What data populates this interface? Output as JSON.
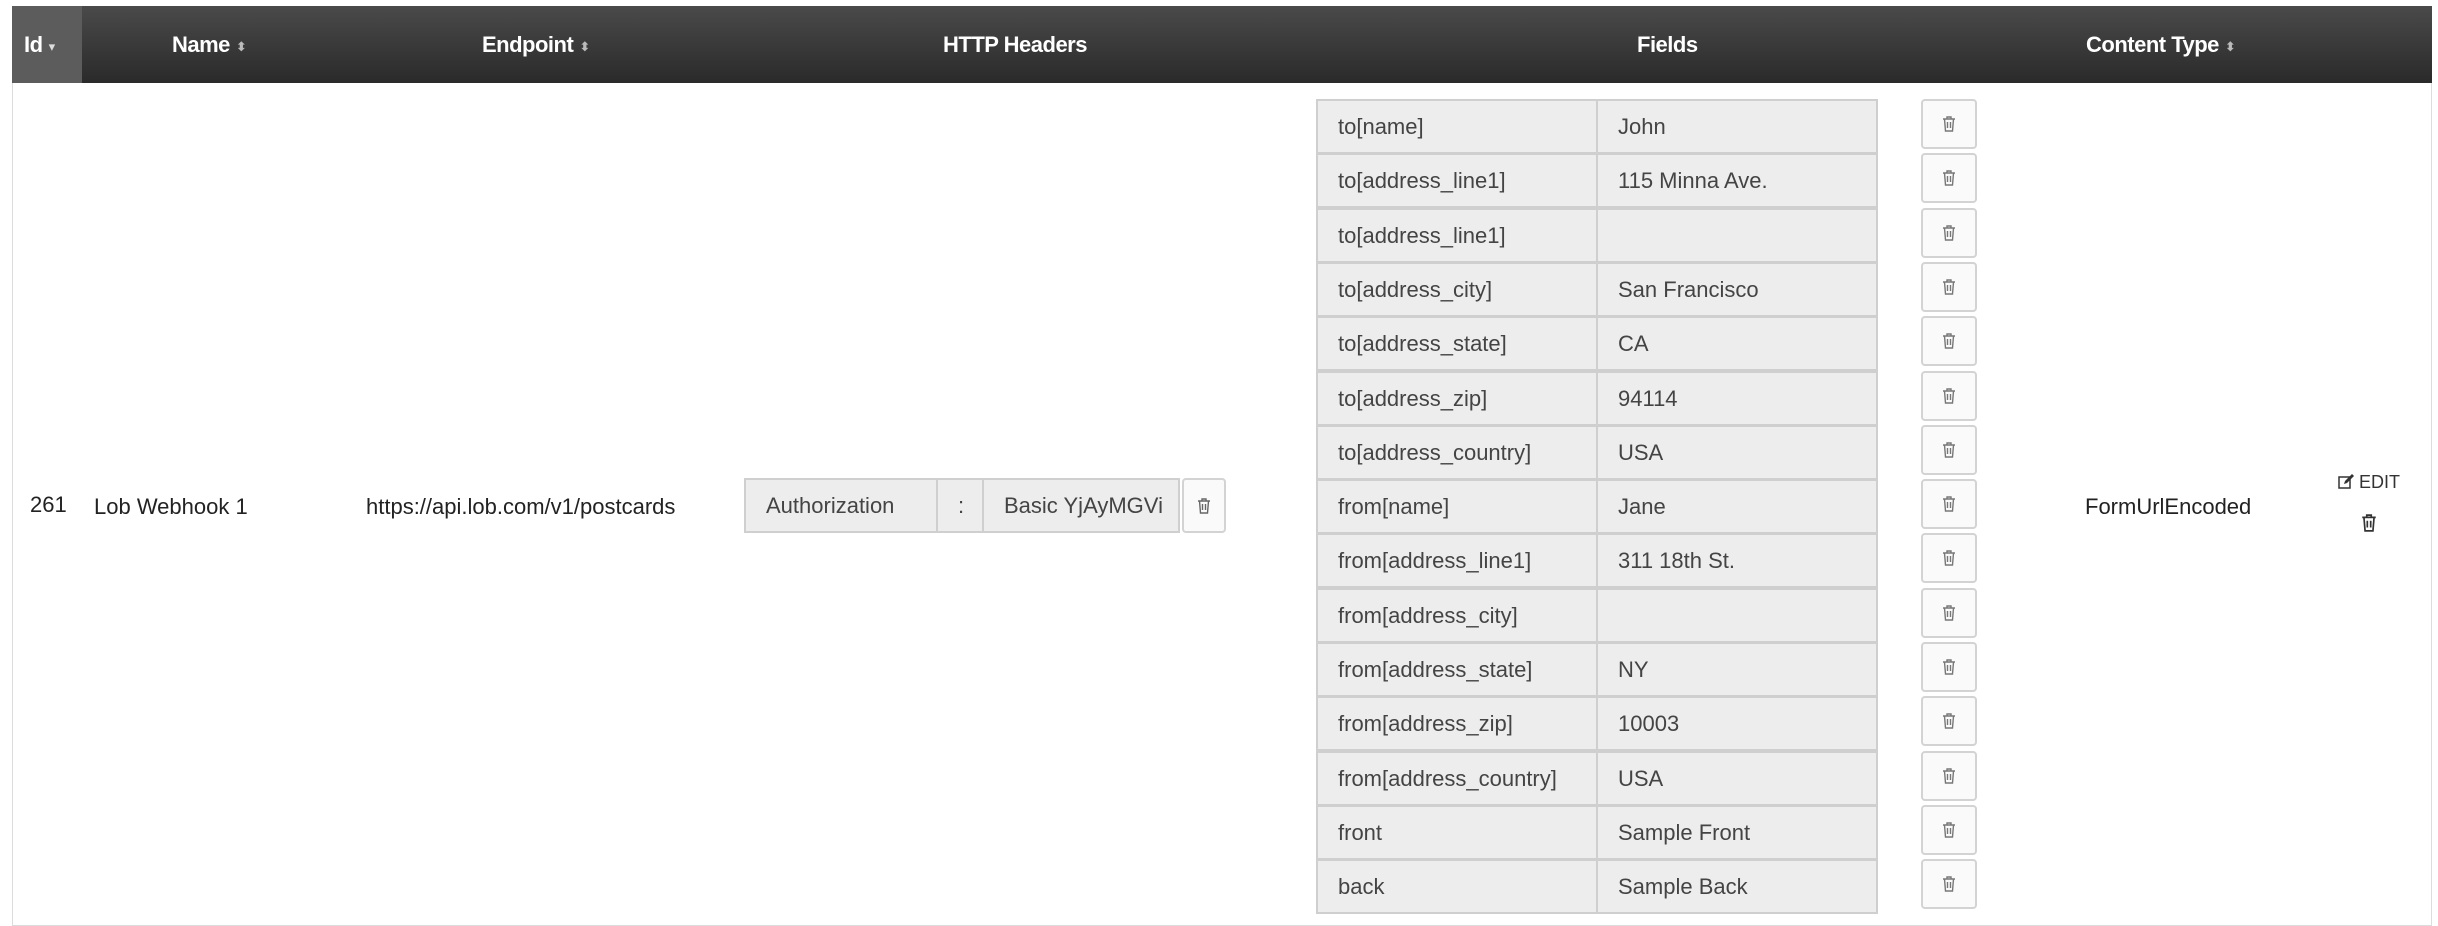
{
  "header": {
    "columns": [
      {
        "label": "Id",
        "sortable": true,
        "sorted": "desc"
      },
      {
        "label": "Name",
        "sortable": true
      },
      {
        "label": "Endpoint",
        "sortable": true
      },
      {
        "label": "HTTP Headers",
        "sortable": false
      },
      {
        "label": "Fields",
        "sortable": false
      },
      {
        "label": "Content Type",
        "sortable": true
      }
    ]
  },
  "row": {
    "id": "261",
    "name": "Lob Webhook 1",
    "endpoint": "https://api.lob.com/v1/postcards",
    "http_headers": [
      {
        "key": "Authorization",
        "separator": ":",
        "value": "Basic YjAyMGVi"
      }
    ],
    "fields": [
      {
        "key": "to[name]",
        "value": "John"
      },
      {
        "key": "to[address_line1]",
        "value": "115 Minna Ave."
      },
      {
        "key": "to[address_line1]",
        "value": ""
      },
      {
        "key": "to[address_city]",
        "value": "San Francisco"
      },
      {
        "key": "to[address_state]",
        "value": "CA"
      },
      {
        "key": "to[address_zip]",
        "value": "94114"
      },
      {
        "key": "to[address_country]",
        "value": "USA"
      },
      {
        "key": "from[name]",
        "value": "Jane"
      },
      {
        "key": "from[address_line1]",
        "value": "311 18th St."
      },
      {
        "key": "from[address_city]",
        "value": ""
      },
      {
        "key": "from[address_state]",
        "value": "NY"
      },
      {
        "key": "from[address_zip]",
        "value": "10003"
      },
      {
        "key": "from[address_country]",
        "value": "USA"
      },
      {
        "key": "front",
        "value": "Sample Front"
      },
      {
        "key": "back",
        "value": "Sample Back"
      }
    ],
    "content_type": "FormUrlEncoded",
    "actions": {
      "edit_label": "EDIT",
      "edit_icon": "edit-icon",
      "delete_icon": "trash-icon"
    }
  },
  "colors": {
    "header_bg": "#333333",
    "header_active_bg": "#5c5c5c",
    "field_bg": "#ededed",
    "border": "#cfcfcf"
  }
}
